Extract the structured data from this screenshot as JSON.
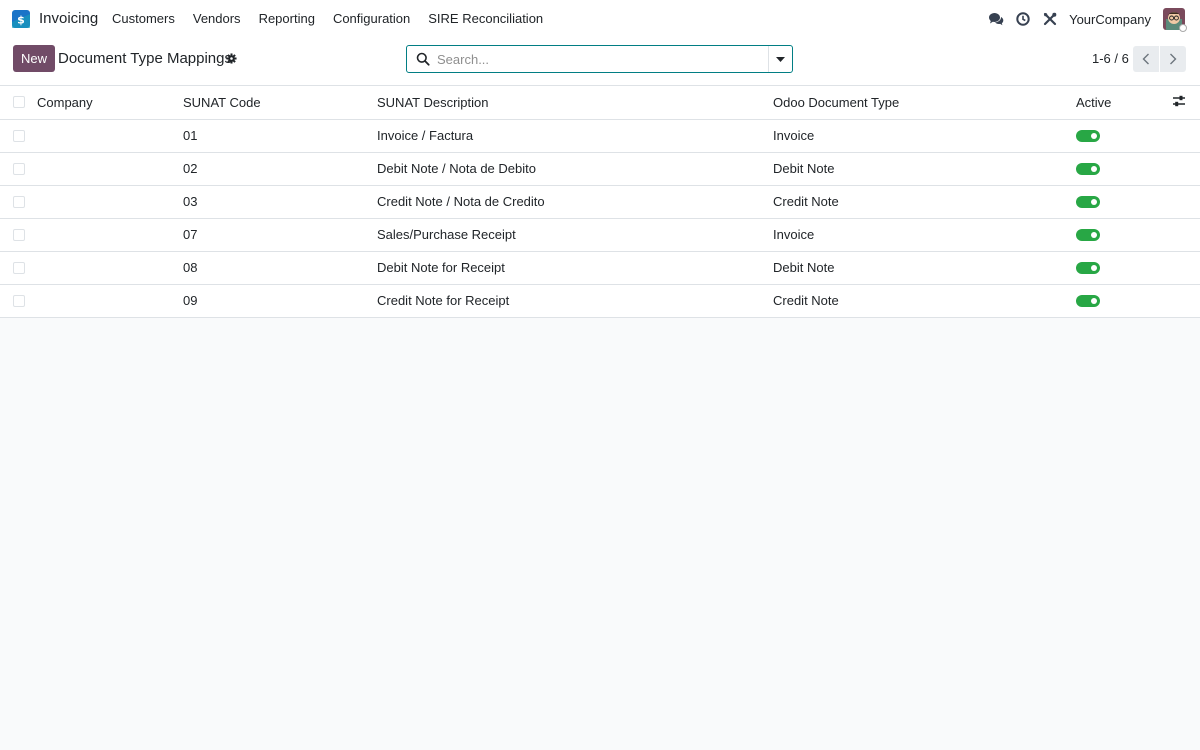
{
  "app": {
    "name": "Invoicing",
    "brand_color": "#1a74c8",
    "accent_color": "#714b67"
  },
  "nav": {
    "items": [
      "Customers",
      "Vendors",
      "Reporting",
      "Configuration",
      "SIRE Reconciliation"
    ]
  },
  "navbar_right": {
    "icons": [
      "chat-icon",
      "clock-icon",
      "tools-icon"
    ],
    "company": "YourCompany"
  },
  "control_panel": {
    "new_label": "New",
    "title": "Document Type Mappings",
    "search_placeholder": "Search...",
    "pager": "1-6 / 6"
  },
  "table": {
    "headers": {
      "company": "Company",
      "code": "SUNAT Code",
      "desc": "SUNAT Description",
      "type": "Odoo Document Type",
      "active": "Active"
    },
    "rows": [
      {
        "company": "",
        "code": "01",
        "desc": "Invoice / Factura",
        "type": "Invoice",
        "active": true
      },
      {
        "company": "",
        "code": "02",
        "desc": "Debit Note / Nota de Debito",
        "type": "Debit Note",
        "active": true
      },
      {
        "company": "",
        "code": "03",
        "desc": "Credit Note / Nota de Credito",
        "type": "Credit Note",
        "active": true
      },
      {
        "company": "",
        "code": "07",
        "desc": "Sales/Purchase Receipt",
        "type": "Invoice",
        "active": true
      },
      {
        "company": "",
        "code": "08",
        "desc": "Debit Note for Receipt",
        "type": "Debit Note",
        "active": true
      },
      {
        "company": "",
        "code": "09",
        "desc": "Credit Note for Receipt",
        "type": "Credit Note",
        "active": true
      }
    ],
    "toggle_on_color": "#28a745"
  }
}
